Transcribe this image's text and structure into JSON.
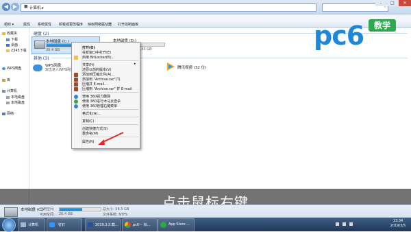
{
  "window": {
    "address_sep": "▸",
    "address": "计算机 ▸",
    "controls": {
      "minimize": "–",
      "maximize": "□",
      "close": "✕"
    }
  },
  "toolbar": {
    "items": [
      "组织 ▾",
      "属性",
      "系统属性",
      "卸载或更改程序",
      "映射网络驱动器",
      "打开控制面板"
    ]
  },
  "nav": {
    "favorites": "收藏夹",
    "downloads": "下载",
    "desktop": "桌面",
    "recent": "2345下载",
    "wps": "WPS网盘",
    "library": "库",
    "computer": "计算机",
    "local_c": "本地磁盘",
    "local_d": "本地磁盘",
    "network": "网络"
  },
  "content": {
    "group_hdd": "硬盘 (2)",
    "group_other": "其他 (3)",
    "drive_c": {
      "name": "本地磁盘 (C:)",
      "free": "26.4 GB",
      "fill": 0.75
    },
    "drive_d": {
      "name": "本地磁盘 (D:)",
      "free": "143 GB",
      "fill": 0.2
    },
    "wps": {
      "name": "WPS网盘",
      "desc": "双击进入WPS网盘"
    },
    "tencent": {
      "name": "腾讯视频 (32 位)"
    }
  },
  "context_menu": {
    "items": [
      "打开(O)",
      "在新窗口中打开(E)",
      "启用 BitLocker(B)...",
      "共享(H)",
      "还原以前的版本(V)",
      "添加到压缩文件(A)...",
      "添加到 \"Archive.rar\"(T)",
      "压缩并 E-mail...",
      "压缩到 \"Archive.rar\" 并 E-mail",
      "使用 360强力删除",
      "使用 360进行木马云查杀",
      "使用 360管理右键菜单",
      "格式化(A)...",
      "复制(C)",
      "创建快捷方式(S)",
      "重命名(M)",
      "属性(R)"
    ],
    "share_arrow": "▸"
  },
  "details": {
    "drive_name": "本地磁盘 (C:)",
    "used_label": "已用空间:",
    "free_label": "可用空间:",
    "free_value": "26.4 GB",
    "total_label": "总大小: 58.5 GB",
    "fs_label": "文件系统: NTFS",
    "fill": 0.55
  },
  "overlay": {
    "logo_text": "pc6",
    "logo_badge": "教学",
    "caption": "点击鼠标右键"
  },
  "taskbar": {
    "items": [
      "计算机",
      "钉钉",
      "2019.3.5.截...",
      "pc6一 标...",
      "App Store ..."
    ],
    "clock_time": "13:34",
    "clock_date": "2019/3/5"
  },
  "colors": {
    "accent": "#1b7cc6",
    "logo_green": "#2fa84f",
    "logo_blue": "#1e88d8",
    "caption_bg": "#000000"
  }
}
